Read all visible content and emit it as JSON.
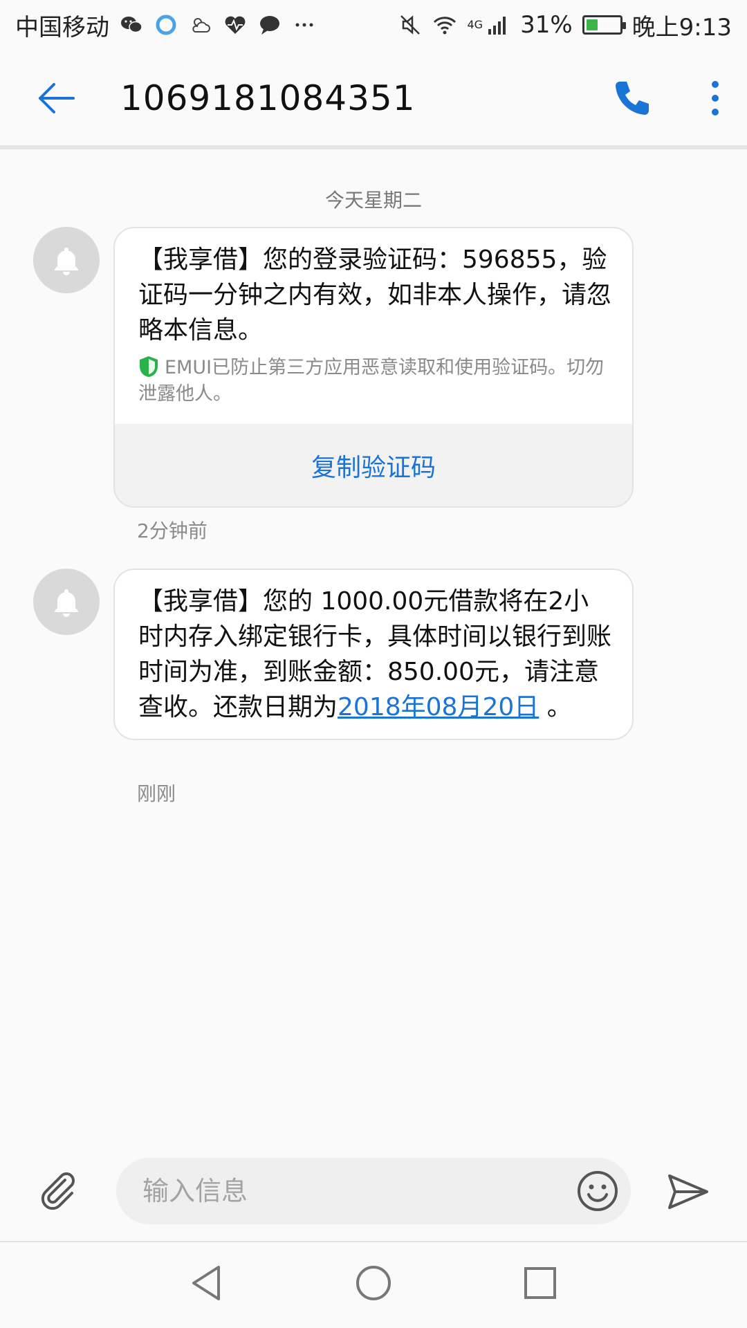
{
  "status_bar": {
    "carrier": "中国移动",
    "battery": "31%",
    "battery_level": 0.31,
    "network": "4G",
    "time": "晚上9:13",
    "notification_icons": [
      "wechat-icon",
      "browser-icon",
      "weather-icon",
      "health-icon",
      "message-icon",
      "more-dots-icon"
    ],
    "system_icons": [
      "mute-icon",
      "wifi-icon",
      "signal-icon",
      "battery-icon"
    ]
  },
  "app_bar": {
    "title": "1069181084351",
    "icons": [
      "back-arrow-icon",
      "phone-icon",
      "more-vert-icon"
    ]
  },
  "date_separator": "今天星期二",
  "messages": [
    {
      "sender_icon": "bell-icon",
      "text": "【我享借】您的登录验证码：596855，验证码一分钟之内有效，如非本人操作，请忽略本信息。",
      "security_note": "EMUI已防止第三方应用恶意读取和使用验证码。切勿泄露他人。",
      "action_label": "复制验证码",
      "time": "2分钟前"
    },
    {
      "sender_icon": "bell-icon",
      "text_before_link": "【我享借】您的 1000.00元借款将在2小时内存入绑定银行卡，具体时间以银行到账时间为准，到账金额：850.00元，请注意查收。还款日期为",
      "link_text": "2018年08月20日",
      "text_after_link": " 。",
      "time": "刚刚"
    }
  ],
  "input_bar": {
    "placeholder": "输入信息",
    "icons": [
      "attachment-icon",
      "emoji-icon",
      "send-icon"
    ]
  },
  "nav_bar": {
    "icons": [
      "back-triangle-icon",
      "home-circle-icon",
      "recents-square-icon"
    ]
  },
  "colors": {
    "accent": "#1a74d6",
    "background": "#fafafa",
    "bubble": "#ffffff",
    "avatar": "#d9d9d9",
    "shield": "#2ab24a",
    "battery_fill": "#39b54a"
  }
}
